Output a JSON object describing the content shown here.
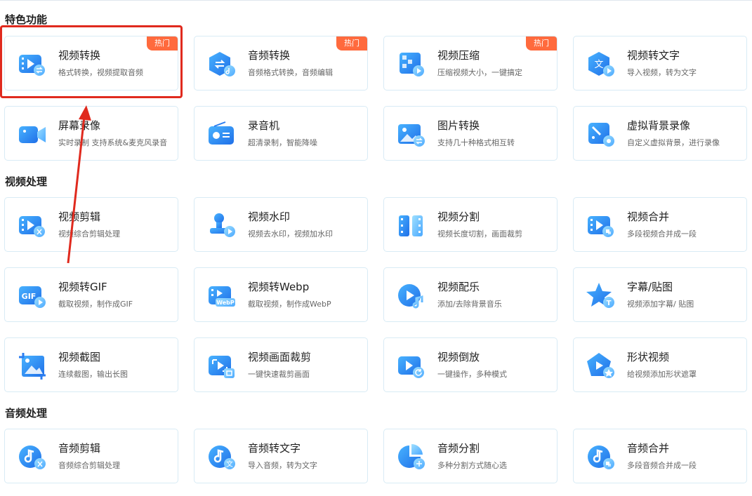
{
  "sections": {
    "featured": "特色功能",
    "video": "视频处理",
    "audio": "音频处理"
  },
  "badge_hot": "热门",
  "cards": {
    "video_convert": {
      "title": "视频转换",
      "desc": "格式转换，视频提取音频"
    },
    "audio_convert": {
      "title": "音频转换",
      "desc": "音频格式转换，音频编辑"
    },
    "video_compress": {
      "title": "视频压缩",
      "desc": "压缩视频大小，一键搞定"
    },
    "video_to_text": {
      "title": "视频转文字",
      "desc": "导入视频，转为文字"
    },
    "screen_record": {
      "title": "屏幕录像",
      "desc": "实时录制 支持系统&麦克风录音"
    },
    "recorder": {
      "title": "录音机",
      "desc": "超清录制，智能降噪"
    },
    "image_convert": {
      "title": "图片转换",
      "desc": "支持几十种格式相互转"
    },
    "virtual_bg": {
      "title": "虚拟背景录像",
      "desc": "自定义虚拟背景，进行录像"
    },
    "video_edit": {
      "title": "视频剪辑",
      "desc": "视频综合剪辑处理"
    },
    "video_watermark": {
      "title": "视频水印",
      "desc": "视频去水印，视频加水印"
    },
    "video_split": {
      "title": "视频分割",
      "desc": "视频长度切割，画面裁剪"
    },
    "video_merge": {
      "title": "视频合并",
      "desc": "多段视频合并成一段"
    },
    "video_gif": {
      "title": "视频转GIF",
      "desc": "截取视频，制作成GIF"
    },
    "video_webp": {
      "title": "视频转Webp",
      "desc": "截取视频，制作成WebP"
    },
    "video_music": {
      "title": "视频配乐",
      "desc": "添加/去除背景音乐"
    },
    "subtitle": {
      "title": "字幕/贴图",
      "desc": "视频添加字幕/ 贴图"
    },
    "video_screenshot": {
      "title": "视频截图",
      "desc": "连续截图，输出长图"
    },
    "video_crop": {
      "title": "视频画面裁剪",
      "desc": "一键快速裁剪画面"
    },
    "video_reverse": {
      "title": "视频倒放",
      "desc": "一键操作，多种模式"
    },
    "shape_video": {
      "title": "形状视频",
      "desc": "给视频添加形状遮罩"
    },
    "audio_edit": {
      "title": "音频剪辑",
      "desc": "音频综合剪辑处理"
    },
    "audio_to_text": {
      "title": "音频转文字",
      "desc": "导入音频，转为文字"
    },
    "audio_split": {
      "title": "音频分割",
      "desc": "多种分割方式随心选"
    },
    "audio_merge": {
      "title": "音频合并",
      "desc": "多段音频合并成一段"
    }
  },
  "icon_text": {
    "gif": "GIF",
    "webp": "WebP",
    "wen": "文",
    "t": "T"
  },
  "colors": {
    "accent_blue": "#2b7df0",
    "hot_badge": "#ff6a3d",
    "highlight_red": "#e02a1e"
  }
}
